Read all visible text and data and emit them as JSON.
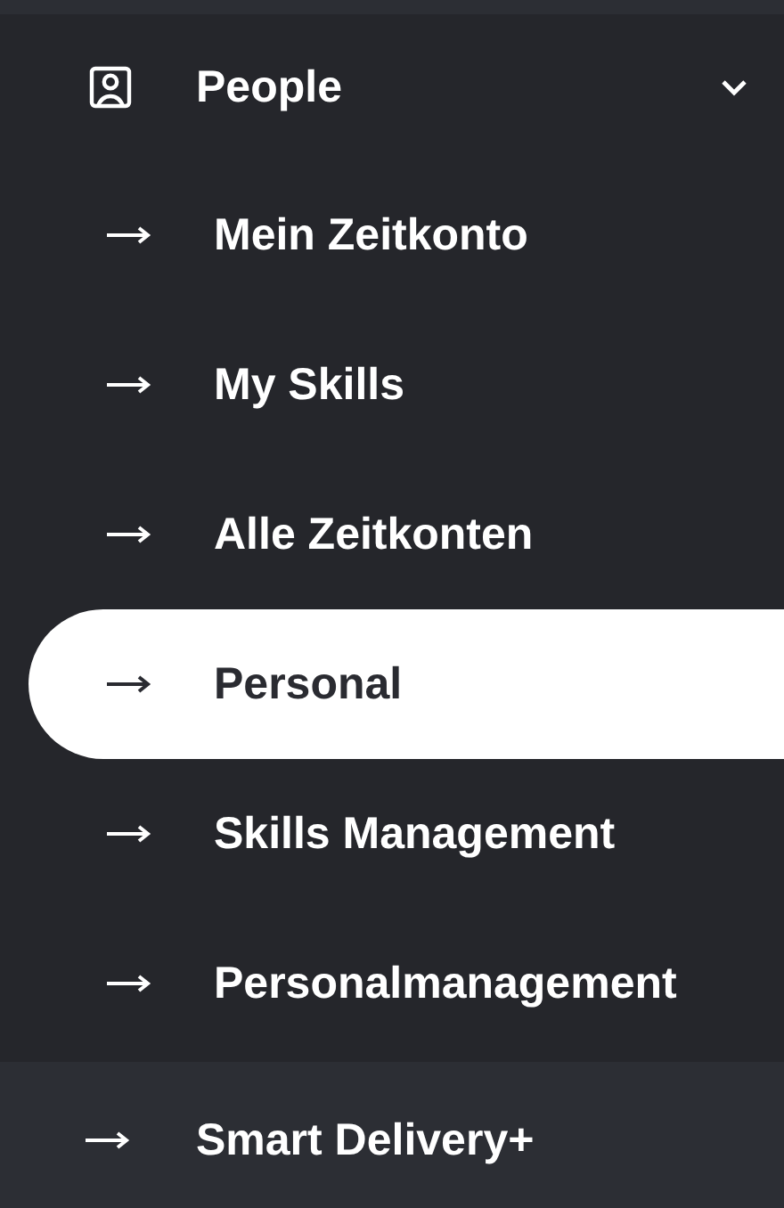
{
  "menu": {
    "group": {
      "label": "People",
      "expanded": true,
      "children": [
        {
          "label": "Mein Zeitkonto",
          "selected": false
        },
        {
          "label": "My Skills",
          "selected": false
        },
        {
          "label": "Alle Zeitkonten",
          "selected": false
        },
        {
          "label": "Personal",
          "selected": true
        },
        {
          "label": "Skills Management",
          "selected": false
        },
        {
          "label": "Personalmanagement",
          "selected": false
        }
      ]
    },
    "items": [
      {
        "label": "Smart Delivery+",
        "selected": false
      }
    ]
  }
}
